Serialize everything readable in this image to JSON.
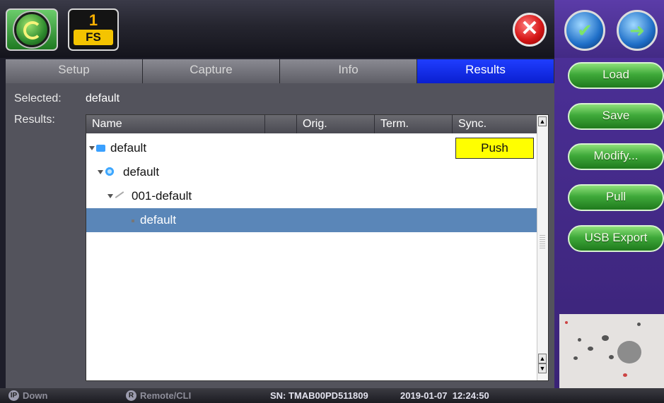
{
  "top": {
    "fs_number": "1",
    "fs_label": "FS",
    "close_glyph": "✕"
  },
  "tabs": [
    {
      "label": "Setup",
      "active": false
    },
    {
      "label": "Capture",
      "active": false
    },
    {
      "label": "Info",
      "active": false
    },
    {
      "label": "Results",
      "active": true
    }
  ],
  "main": {
    "selected_label": "Selected:",
    "selected_value": "default",
    "results_label": "Results:",
    "columns": [
      "Name",
      "",
      "Orig.",
      "Term.",
      "Sync."
    ],
    "rows": [
      {
        "name": "default",
        "icon": "folder-icon",
        "selected": false
      },
      {
        "name": "default",
        "icon": "gear-icon",
        "selected": false
      },
      {
        "name": "001-default",
        "icon": "trace-icon",
        "selected": false
      },
      {
        "name": "default",
        "icon": "dot-icon",
        "selected": true
      }
    ],
    "push_label": "Push"
  },
  "side_buttons": [
    "Load",
    "Save",
    "Modify...",
    "Pull",
    "USB Export"
  ],
  "status": {
    "ip_icon": "IP",
    "link": "Down",
    "remote_icon": "R",
    "remote": "Remote/CLI",
    "serial": "SN: TMAB00PD511809",
    "datetime": "2019-01-07  12:24:50"
  },
  "colors": {
    "active_tab": "#0a1fd0",
    "selection": "#5a86b8",
    "push": "#ffff00",
    "side_button": "#3fa93a"
  }
}
